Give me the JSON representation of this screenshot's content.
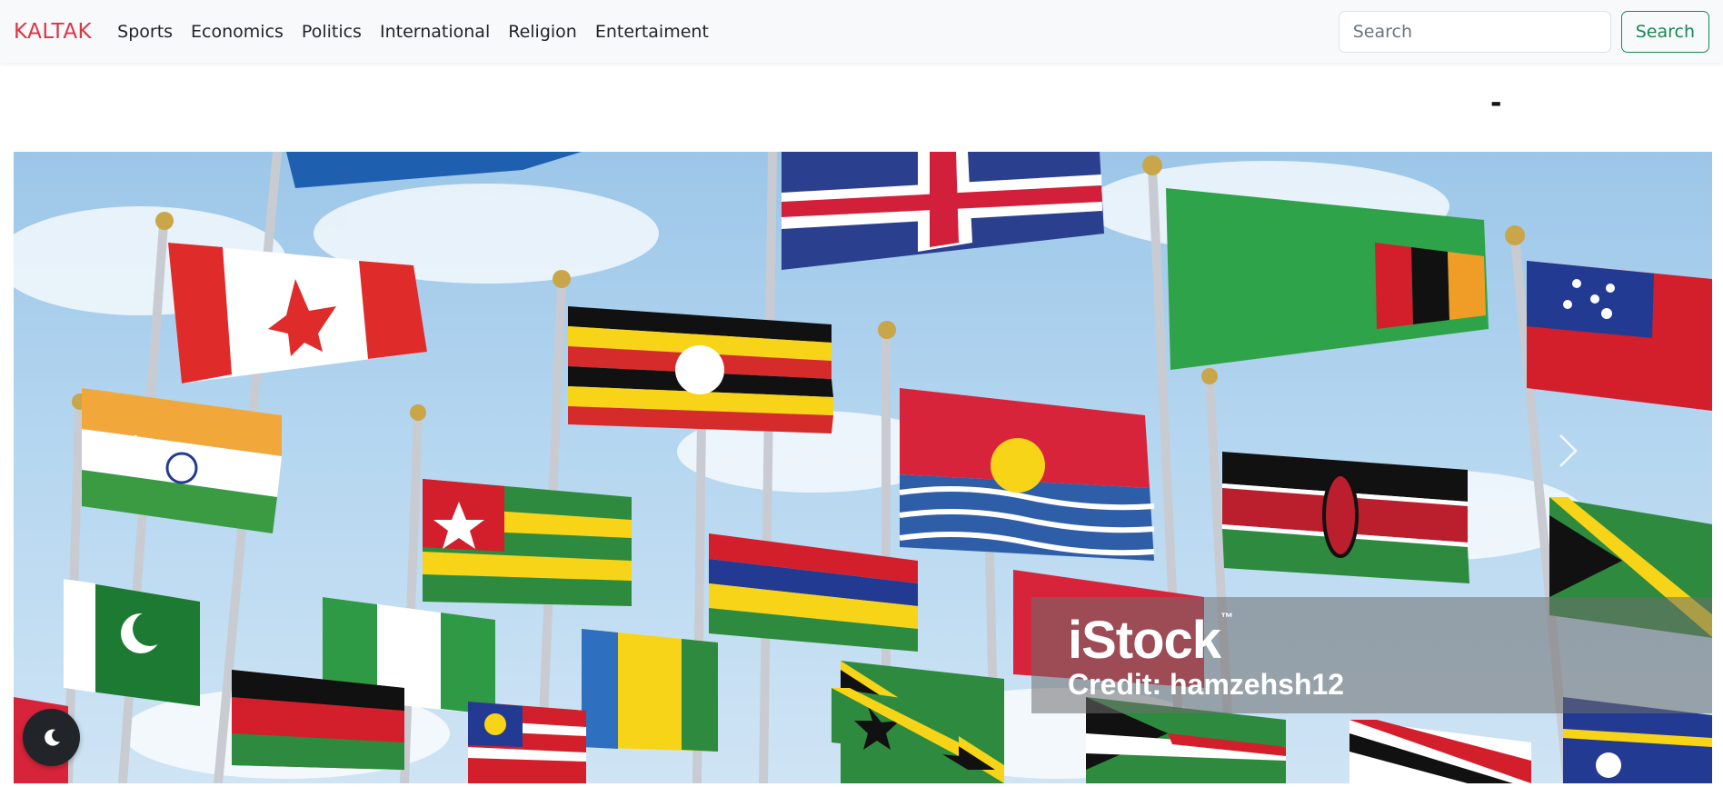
{
  "navbar": {
    "brand": "KALTAK",
    "links": [
      {
        "label": "Sports"
      },
      {
        "label": "Economics"
      },
      {
        "label": "Politics"
      },
      {
        "label": "International"
      },
      {
        "label": "Religion"
      },
      {
        "label": "Entertaiment"
      }
    ],
    "search": {
      "placeholder": "Search",
      "button_label": "Search"
    }
  },
  "headline": "-",
  "carousel": {
    "watermark_brand": "iStock",
    "watermark_trademark": "™",
    "watermark_credit": "Credit: hamzehsh12",
    "prev_icon": "chevron-left-icon",
    "next_icon": "chevron-right-icon"
  },
  "theme_toggle": {
    "icon": "moon-icon"
  },
  "colors": {
    "brand": "#dc3545",
    "search_button": "#198754",
    "navbar_bg": "#f8f9fa",
    "toggle_bg": "#212529"
  }
}
